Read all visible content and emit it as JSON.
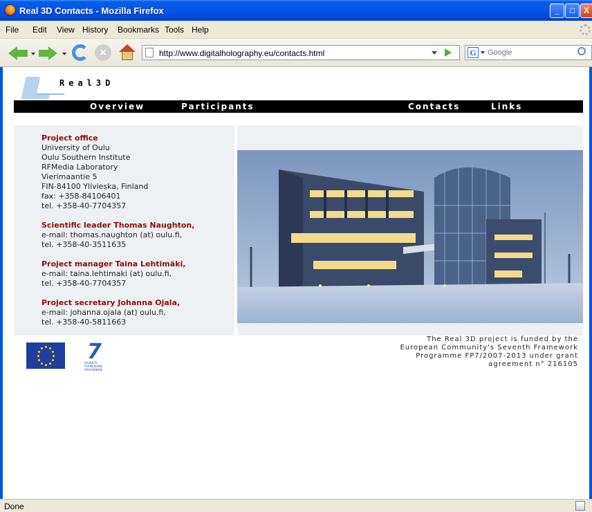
{
  "window": {
    "title": "Real 3D Contacts - Mozilla Firefox",
    "controls": {
      "minimize": "_",
      "maximize": "□",
      "close": "X"
    }
  },
  "menu": [
    "File",
    "Edit",
    "View",
    "History",
    "Bookmarks",
    "Tools",
    "Help"
  ],
  "toolbar": {
    "url": "http://www.digitalholography.eu/contacts.html",
    "search_placeholder": "Google",
    "search_engine_letter": "G",
    "stop_glyph": "×",
    "icons": [
      "back-arrow-icon",
      "forward-arrow-icon",
      "reload-icon",
      "stop-icon",
      "home-icon",
      "page-icon",
      "go-icon",
      "google-icon",
      "search-icon"
    ]
  },
  "site": {
    "name": "Real3D",
    "nav": [
      "Overview",
      "Participants",
      "Contacts",
      "Links"
    ]
  },
  "contacts": {
    "office": {
      "heading": "Project office",
      "lines": [
        "University of Oulu",
        "Oulu Southern Institute",
        "RFMedia Laboratory",
        "Vierimaantie 5",
        "FIN-84100 Ylivieska, Finland",
        "fax: +358-84106401",
        "tel. +358-40-7704357"
      ]
    },
    "people": [
      {
        "heading": "Scientific leader Thomas Naughton,",
        "email": "e-mail: thomas.naughton (at) oulu.fi,",
        "tel": "tel. +358-40-3511635"
      },
      {
        "heading": "Project manager Taina Lehtimäki,",
        "email": "e-mail: taina.lehtimaki (at) oulu.fi,",
        "tel": "tel. +358-40-7704357"
      },
      {
        "heading": "Project secretary Johanna Ojala,",
        "email": "e-mail: johanna.ojala (at) oulu.fi,",
        "tel": "tel. +358-40-5811663"
      }
    ]
  },
  "footer": {
    "funding": [
      "The Real 3D project is funded by the",
      "European Community's Seventh Framework",
      "Programme FP7/2007-2013 under grant",
      "agreement n° 216105"
    ],
    "fp7_mark": "7",
    "fp7_caption": "SEVENTH FRAMEWORK PROGRAMME"
  },
  "status": {
    "text": "Done"
  },
  "colors": {
    "title_bar": "#0055e5",
    "heading": "#8b0d0d",
    "panel": "#eef1f4",
    "nav_bar": "#000000"
  }
}
